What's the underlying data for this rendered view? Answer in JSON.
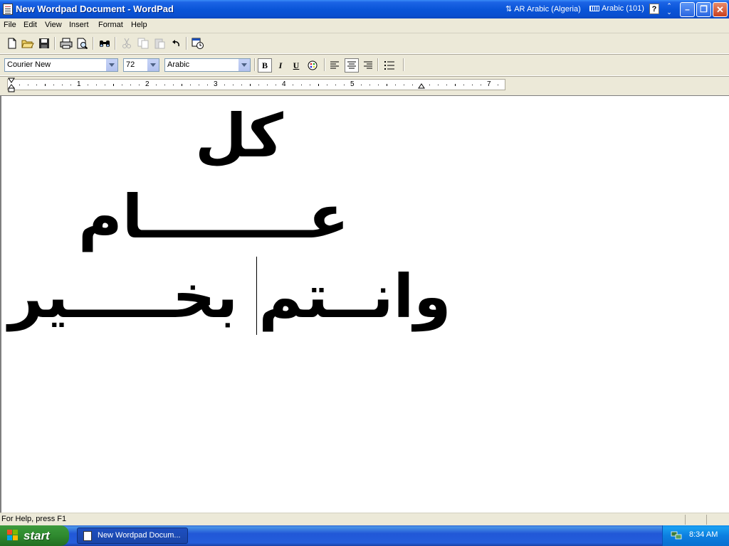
{
  "window": {
    "title": "New Wordpad Document - WordPad",
    "language": "AR Arabic (Algeria)",
    "keyboard": "Arabic (101)",
    "help_glyph": "?",
    "controls": {
      "minimize": "–",
      "maximize": "❐",
      "close": "✕"
    }
  },
  "menu": [
    "File",
    "Edit",
    "View",
    "Insert",
    "Format",
    "Help"
  ],
  "toolbar": {
    "icons": [
      "new-document-icon",
      "open-icon",
      "save-icon",
      "print-icon",
      "print-preview-icon",
      "find-icon",
      "cut-icon",
      "copy-icon",
      "paste-icon",
      "undo-icon",
      "insert-datetime-icon"
    ]
  },
  "format_bar": {
    "font": "Courier New",
    "size": "72",
    "script": "Arabic",
    "bold": "B",
    "italic": "I",
    "underline": "U",
    "bold_pressed": true,
    "align_center_pressed": true
  },
  "ruler": {
    "numbers": [
      "1",
      "2",
      "3",
      "4",
      "5",
      "7"
    ]
  },
  "document": {
    "lines": [
      "كل",
      "عــــــــام",
      "وانــتم بخـــــير"
    ]
  },
  "status": {
    "help": "For Help, press F1"
  },
  "taskbar": {
    "start": "start",
    "task": "New Wordpad Docum...",
    "clock": "8:34 AM"
  },
  "colors": {
    "titlebar": "#0a55d8",
    "taskbar": "#245edb",
    "start": "#2f8a2f"
  }
}
